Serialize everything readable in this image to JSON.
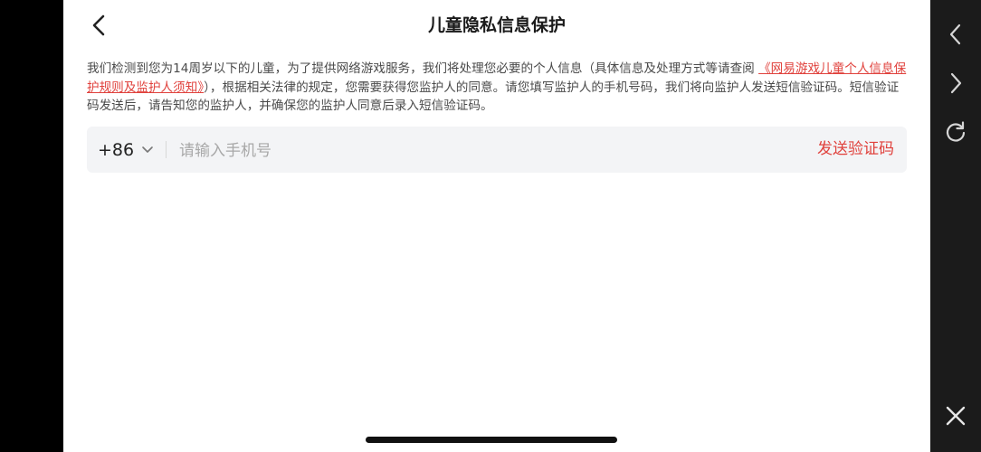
{
  "header": {
    "title": "儿童隐私信息保护",
    "back_icon": "chevron-left-icon"
  },
  "notice": {
    "text_before_link": "我们检测到您为14周岁以下的儿童，为了提供网络游戏服务，我们将处理您必要的个人信息（具体信息及处理方式等请查阅 ",
    "link_text": "《网易游戏儿童个人信息保护规则及监护人须知》",
    "text_after_link": "），根据相关法律的规定，您需要获得您监护人的同意。请您填写监护人的手机号码，我们将向监护人发送短信验证码。短信验证码发送后，请告知您的监护人，并确保您的监护人同意后录入短信验证码。"
  },
  "phone": {
    "country_code": "+86",
    "placeholder": "请输入手机号",
    "value": "",
    "send_code_label": "发送验证码"
  },
  "rail": {
    "icons": [
      "chevron-left-icon",
      "chevron-right-icon",
      "refresh-icon",
      "close-icon"
    ]
  },
  "colors": {
    "accent": "#e0413c",
    "text": "#4a4a4a",
    "input_bg": "#f3f4f6",
    "rail_bg": "#1b1b1b"
  }
}
